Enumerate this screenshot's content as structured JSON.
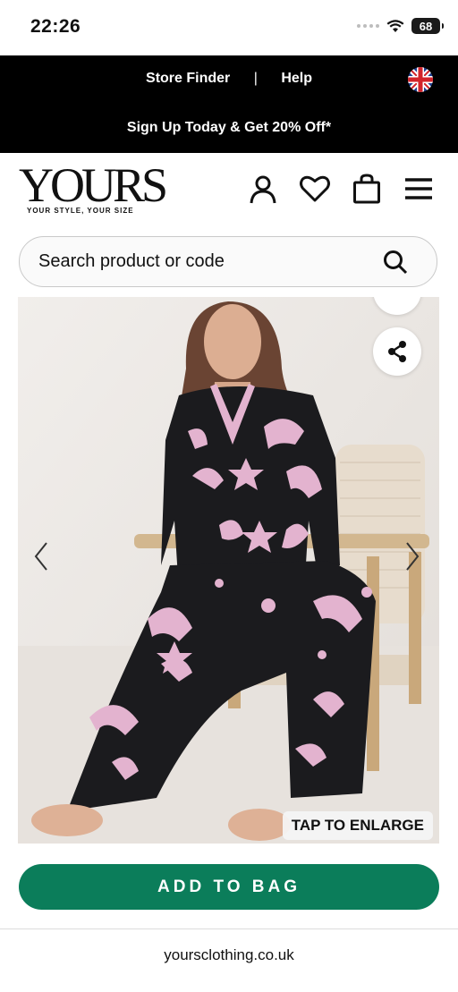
{
  "status": {
    "time": "22:26",
    "battery": "68"
  },
  "header": {
    "store_finder": "Store Finder",
    "separator": "|",
    "help": "Help",
    "promo": "Sign Up Today & Get 20% Off*",
    "flag_icon": "uk-flag-icon"
  },
  "brand": {
    "logo": "YOURS",
    "tagline": "YOUR STYLE, YOUR SIZE"
  },
  "nav": {
    "icons": [
      "account-icon",
      "wishlist-heart-icon",
      "shopping-bag-icon",
      "menu-icon"
    ]
  },
  "search": {
    "placeholder": "Search product or code",
    "icon": "search-icon"
  },
  "product": {
    "image_alt": "Black satin pyjama set with pink cat and moon print",
    "enlarge_label": "TAP TO ENLARGE",
    "colors": {
      "pyjama": "#1b1b1e",
      "print": "#e3b3cf",
      "background": "#ebe7e4"
    }
  },
  "actions": {
    "add_to_bag": "ADD TO BAG",
    "button_color": "#0b7d5a"
  },
  "browser": {
    "url": "yoursclothing.co.uk"
  }
}
